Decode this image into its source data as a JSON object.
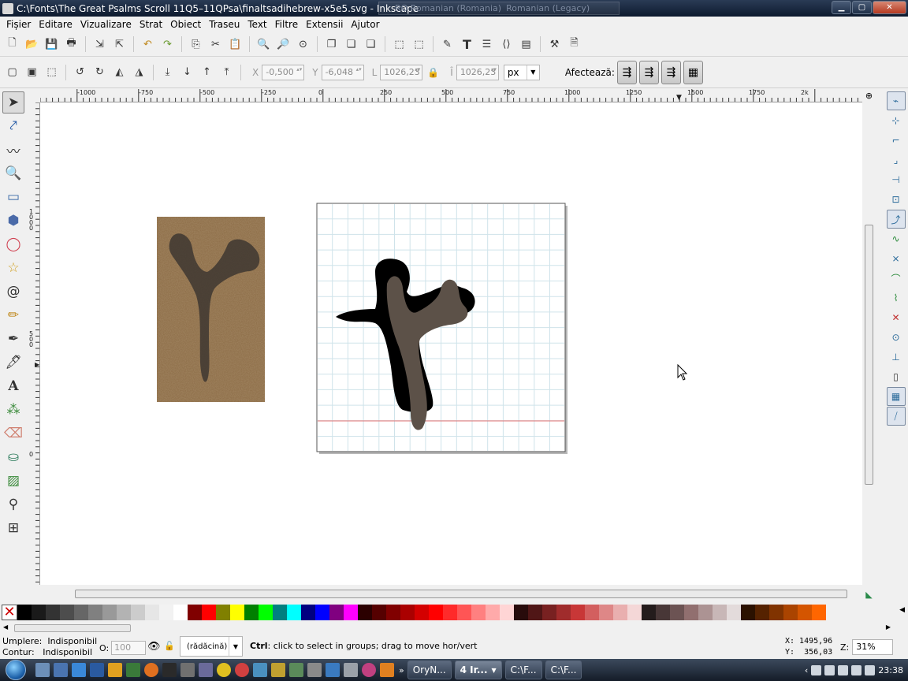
{
  "window": {
    "title": "C:\\Fonts\\The Great Psalms Scroll 11Q5–11QPsa\\finaltsadihebrew-x5e5.svg - Inkscape",
    "language_bar": "RO Romanian (Romania)",
    "keyboard": "Romanian (Legacy)",
    "buttons": {
      "minimize": "▁",
      "maximize": "▢",
      "close": "✕"
    }
  },
  "menu": [
    "Fișier",
    "Editare",
    "Vizualizare",
    "Strat",
    "Obiect",
    "Traseu",
    "Text",
    "Filtre",
    "Extensii",
    "Ajutor"
  ],
  "toolbar": {
    "icons": [
      "new-icon",
      "open-icon",
      "save-icon",
      "print-icon",
      "import-icon",
      "export-icon",
      "undo-icon",
      "redo-icon",
      "copy-icon",
      "cut-icon",
      "paste-icon",
      "zoom-selection-icon",
      "zoom-drawing-icon",
      "zoom-page-icon",
      "duplicate-icon",
      "clone-icon",
      "unlink-clone-icon",
      "group-icon",
      "ungroup-icon",
      "fill-stroke-icon",
      "text-font-icon",
      "layers-icon",
      "xml-editor-icon",
      "align-icon",
      "preferences-icon",
      "document-properties-icon"
    ]
  },
  "controls": {
    "x_label": "X",
    "x_value": "-0,500",
    "y_label": "Y",
    "y_value": "-6,048",
    "w_label": "L",
    "w_value": "1026,23",
    "h_label": "Î",
    "h_value": "1026,23",
    "unit": "px",
    "affect_label": "Afectează:"
  },
  "tools": [
    "selector-tool",
    "node-tool",
    "tweak-tool",
    "zoom-tool",
    "rectangle-tool",
    "3d-box-tool",
    "ellipse-tool",
    "star-tool",
    "spiral-tool",
    "pencil-tool",
    "pen-tool",
    "calligraphy-tool",
    "text-tool",
    "spray-tool",
    "eraser-tool",
    "paint-bucket-tool",
    "gradient-tool",
    "dropper-tool",
    "connector-tool"
  ],
  "ruler": {
    "h_labels": [
      "-1000",
      "-750",
      "-500",
      "-250",
      "0",
      "250",
      "500",
      "750",
      "1000",
      "1250",
      "1500",
      "1750",
      "2k"
    ],
    "v_labels": [
      "1000",
      "500",
      "0"
    ]
  },
  "snap": [
    "snap-toggle",
    "snap-bbox",
    "snap-bbox-edge",
    "snap-bbox-corner",
    "snap-bbox-midpoint",
    "snap-bbox-center",
    "snap-nodes",
    "snap-paths",
    "snap-intersections",
    "snap-smooth",
    "snap-midpoints",
    "snap-object-centers",
    "snap-rotation-center",
    "snap-page-border",
    "snap-grid",
    "snap-guides"
  ],
  "palette_colors": [
    "#000000",
    "#1a1a1a",
    "#333333",
    "#4d4d4d",
    "#666666",
    "#808080",
    "#999999",
    "#b3b3b3",
    "#cccccc",
    "#e6e6e6",
    "#f2f2f2",
    "#ffffff",
    "#800000",
    "#ff0000",
    "#808000",
    "#ffff00",
    "#008000",
    "#00ff00",
    "#008080",
    "#00ffff",
    "#000080",
    "#0000ff",
    "#800080",
    "#ff00ff",
    "#2b0000",
    "#550000",
    "#800000",
    "#aa0000",
    "#d40000",
    "#ff0000",
    "#ff2a2a",
    "#ff5555",
    "#ff8080",
    "#ffaaaa",
    "#ffd5d5",
    "#280b0b",
    "#501616",
    "#782121",
    "#a02c2c",
    "#c83737",
    "#d35f5f",
    "#de8787",
    "#e9afaf",
    "#f4d7d7",
    "#241c1c",
    "#483737",
    "#6c5353",
    "#916f6f",
    "#ac9393",
    "#c8b7b7",
    "#e3dbdb",
    "#2b1100",
    "#552200",
    "#803300",
    "#aa4400",
    "#d45500",
    "#ff6600"
  ],
  "status": {
    "fill_label": "Umplere:",
    "fill_value": "Indisponibil",
    "stroke_label": "Contur:",
    "stroke_value": "Indisponibil",
    "opacity_label": "O:",
    "opacity_value": "100",
    "layer": "(rădăcină)",
    "message_key": "Ctrl",
    "message": ": click to select in groups; drag to move hor/vert",
    "coord_x": "X: 1495,96",
    "coord_y": "Y:  356,03",
    "zoom_label": "Z:",
    "zoom_value": "31%"
  },
  "taskbar": {
    "tasks": [
      "OryN...",
      "4 Ir...",
      "C:\\F...",
      "C:\\F..."
    ],
    "clock": "23:38"
  },
  "colors": {
    "grid": "#cfe3ea",
    "baseline": "#e07070",
    "glyph_black": "#000000",
    "glyph_brown": "#5c5148",
    "parchment": "#8a6a44"
  }
}
